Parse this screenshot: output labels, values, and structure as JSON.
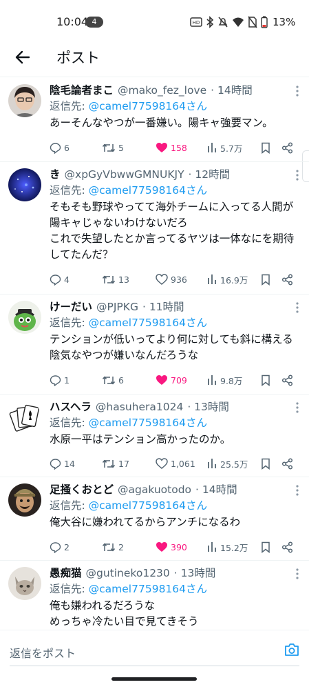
{
  "status_bar": {
    "time": "10:04",
    "notification_count": "4",
    "battery": "13%"
  },
  "header": {
    "title": "ポスト"
  },
  "tweets": [
    {
      "display_name": "陰毛論者まこ",
      "handle": "@mako_fez_love",
      "time": "· 14時間",
      "reply_label": "返信先: ",
      "reply_mention": "@camel77598164さん",
      "text": "あーそんなやつが一番嫌い。陽キャ強要マン。",
      "replies": "6",
      "retweets": "5",
      "likes": "158",
      "liked": true,
      "views": "5.7万"
    },
    {
      "display_name": "き",
      "handle": "@xpGyVbwwGMNUKJY",
      "time": "· 12時間",
      "reply_label": "返信先: ",
      "reply_mention": "@camel77598164さん",
      "text": "そもそも野球やってて海外チームに入ってる人間が陽キャじゃないわけないだろ\nこれで失望したとか言ってるヤツは一体なにを期待してたんだ？",
      "replies": "4",
      "retweets": "13",
      "likes": "936",
      "liked": false,
      "views": "16.9万"
    },
    {
      "display_name": "けーだい",
      "handle": "@PJPKG",
      "time": "· 11時間",
      "reply_label": "返信先: ",
      "reply_mention": "@camel77598164さん",
      "text": "テンションが低いってより何に対しても斜に構える陰気なやつが嫌いなんだろうな",
      "replies": "1",
      "retweets": "6",
      "likes": "709",
      "liked": true,
      "views": "9.8万"
    },
    {
      "display_name": "ハスヘラ",
      "handle": "@hasuhera1024",
      "time": "· 13時間",
      "reply_label": "返信先: ",
      "reply_mention": "@camel77598164さん",
      "text": "水原一平はテンション高かったのか。",
      "replies": "14",
      "retweets": "17",
      "likes": "1,061",
      "liked": false,
      "views": "25.5万"
    },
    {
      "display_name": "足掻くおとど",
      "handle": "@agakuotodo",
      "time": "· 14時間",
      "reply_label": "返信先: ",
      "reply_mention": "@camel77598164さん",
      "text": "俺大谷に嫌われてるからアンチになるわ",
      "replies": "2",
      "retweets": "2",
      "likes": "390",
      "liked": true,
      "views": "15.2万"
    },
    {
      "display_name": "愚痴猫",
      "handle": "@gutineko1230",
      "time": "· 13時間",
      "reply_label": "返信先: ",
      "reply_mention": "@camel77598164さん",
      "text": "俺も嫌われるだろうな\nめっちゃ冷たい目で見てきそう"
    }
  ],
  "reply_bar": {
    "placeholder": "返信をポスト"
  },
  "colors": {
    "accent": "#1d9bf0",
    "like": "#f91880",
    "secondary_text": "#536471"
  }
}
